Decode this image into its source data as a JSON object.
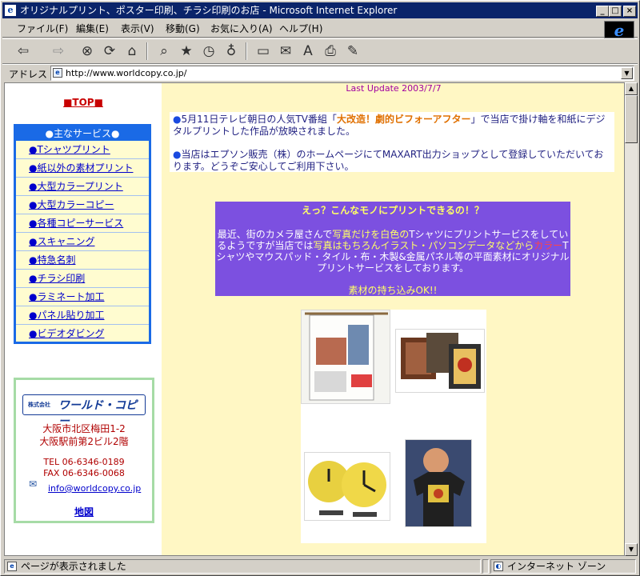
{
  "window": {
    "title": "オリジナルプリント、ポスター印刷、チラシ印刷のお店 - Microsoft Internet Explorer"
  },
  "menu": [
    "ファイル(F)",
    "編集(E)",
    "表示(V)",
    "移動(G)",
    "お気に入り(A)",
    "ヘルプ(H)"
  ],
  "address": {
    "label": "アドレス",
    "url": "http://www.worldcopy.co.jp/"
  },
  "left": {
    "top_link": "■TOP■",
    "services_title": "●主なサービス●",
    "services": [
      "●Tシャツプリント",
      "●紙以外の素材プリント",
      "●大型カラープリント",
      "●大型カラーコピー",
      "●各種コピーサービス",
      "●スキャニング",
      "●特急名刺",
      "●チラシ印刷",
      "●ラミネート加工",
      "●パネル貼り加工",
      "●ビデオダビング"
    ],
    "company": {
      "logo_small": "株式会社",
      "logo_name": "ワールド・コピー",
      "addr1": "大阪市北区梅田1-2",
      "addr2": "大阪駅前第2ビル2階",
      "tel": "TEL 06-6346-0189",
      "fax": "FAX 06-6346-0068",
      "email": "info@worldcopy.co.jp",
      "map": "地図"
    }
  },
  "main": {
    "last_update": "Last Update 2003/7/7",
    "news1_a": "●",
    "news1_b": "5月11日テレビ朝日の人気TV番組「",
    "news1_c": "大改造！劇的ビフォーアフター",
    "news1_d": "」で当店で掛け軸を和紙にデジタルプリントした作品が放映されました。",
    "news2_a": "●",
    "news2_b": "当店はエプソン販売（株）のホームページにてMAXART出力ショップとして登録していただいております。どうぞご安心してご利用下さい。",
    "promo_title": "えっ？こんなモノにプリントできるの！？",
    "promo_1": "最近、街のカメラ屋さんで",
    "promo_2": "写真だけを白色の",
    "promo_3": "Tシャツにプリントサービスをしているようですが当店では",
    "promo_4": "写真はもちろんイラスト・パソコンデータなどから",
    "promo_5": "カラー",
    "promo_6": "Tシャツやマウスパッド・タイル・布・木製&金属パネル等の平面素材にオリジナルプリントサービスをしております。",
    "promo_foot": "素材の持ち込みOK!!"
  },
  "status": {
    "text": "ページが表示されました",
    "zone": "インターネット ゾーン"
  }
}
